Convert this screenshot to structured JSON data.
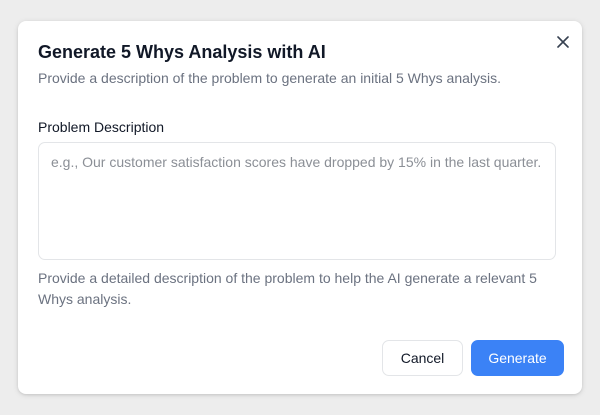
{
  "dialog": {
    "title": "Generate 5 Whys Analysis with AI",
    "subtitle": "Provide a description of the problem to generate an initial 5 Whys analysis.",
    "close_icon": "close-icon"
  },
  "form": {
    "problem_label": "Problem Description",
    "problem_value": "",
    "problem_placeholder": "e.g., Our customer satisfaction scores have dropped by 15% in the last quarter.",
    "help_text": "Provide a detailed description of the problem to help the AI generate a relevant 5 Whys analysis."
  },
  "actions": {
    "cancel_label": "Cancel",
    "generate_label": "Generate"
  },
  "colors": {
    "primary": "#3b82f6",
    "text": "#111827",
    "muted": "#6b7280",
    "border": "#e3e5e8"
  }
}
